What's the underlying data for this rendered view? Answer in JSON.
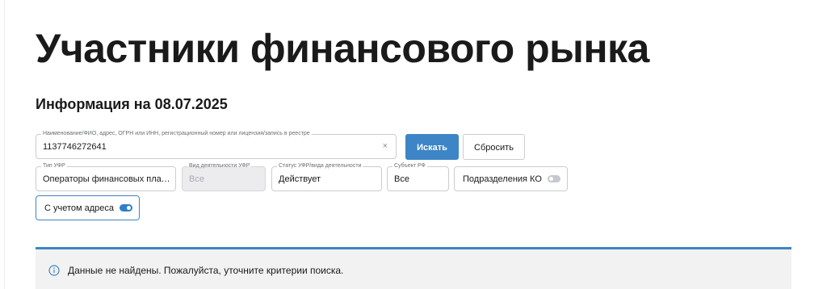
{
  "page": {
    "title": "Участники финансового рынка",
    "info_date": "Информация на 08.07.2025"
  },
  "search": {
    "label": "Наименование/ФИО, адрес, ОГРН или ИНН, регистрационный номер или лицензия/запись в реестре",
    "value": "1137746272641",
    "clear_icon": "close-icon",
    "clear_glyph": "×",
    "search_button": "Искать",
    "reset_button": "Сбросить"
  },
  "filters": {
    "type": {
      "label": "Тип УФР",
      "value": "Операторы финансовых плат…"
    },
    "activity": {
      "label": "Вид деятельности УФР",
      "value": "Все",
      "disabled": true
    },
    "status": {
      "label": "Статус УФР/вида деятельности",
      "value": "Действует"
    },
    "subject": {
      "label": "Субъект РФ",
      "value": "Все"
    },
    "ko_divisions": {
      "label": "Подразделения КО",
      "toggle": "off"
    },
    "with_address": {
      "label": "С учетом адреса",
      "toggle": "on"
    }
  },
  "notice": {
    "icon": "info-icon",
    "text": "Данные не найдены. Пожалуйста, уточните критерии поиска."
  },
  "colors": {
    "accent": "#3d85c6",
    "toggle_on": "#2f7fc9",
    "toggle_off": "#c5c8cc",
    "notice_bg": "#f2f2f2"
  }
}
